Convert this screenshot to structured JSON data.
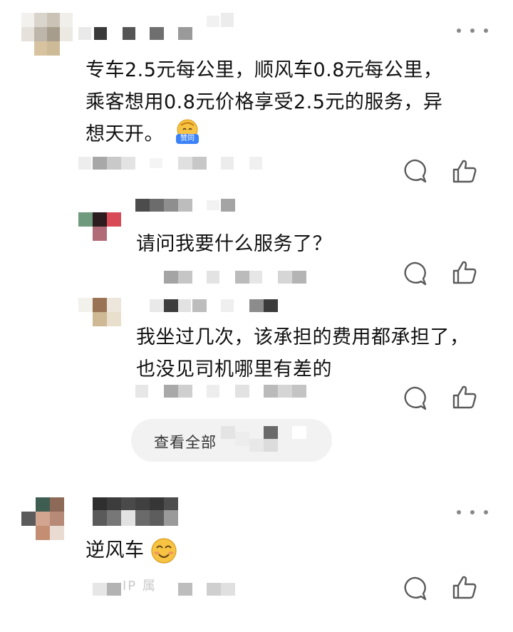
{
  "comments": [
    {
      "id": "c1",
      "text_lines": [
        "专车2.5元每公里，顺风车0.8元每公里，",
        "乘客想用0.8元价格享受2.5元的服务，异",
        "想天开。"
      ],
      "emoji_label": "赞同",
      "replies": [
        {
          "text_lines": [
            "请问我要什么服务了？"
          ]
        },
        {
          "text_lines": [
            "我坐过几次，该承担的费用都承担了，",
            "也没见司机哪里有差的"
          ]
        }
      ],
      "view_all_label": "查看全部"
    },
    {
      "id": "c2",
      "text_lines": [
        "逆风车"
      ],
      "meta_fragment": "IP 属"
    }
  ],
  "icons": {
    "more": "more-dots-icon",
    "comment": "comment-bubble-icon",
    "like": "thumbs-up-icon",
    "emoji_agree": "agree-emoji-icon",
    "emoji_smile": "smile-emoji-icon"
  },
  "colors": {
    "icon_stroke": "#5a5a5a",
    "emoji_yellow": "#f6c343",
    "badge_blue": "#3b82f6"
  }
}
